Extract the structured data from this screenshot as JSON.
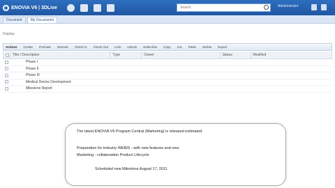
{
  "topbar": {
    "app_title": "ENOVIA V6 | 3DLive",
    "search_placeholder": "Search",
    "user_label": "Administrator"
  },
  "tabs": [
    "Document",
    "My Documents"
  ],
  "filter": {
    "label": "Display:"
  },
  "toolbar": {
    "items": [
      "Actions",
      "Create",
      "Promote",
      "Demote",
      "Check In",
      "Check Out",
      "Lock",
      "Unlock",
      "Subscribe",
      "Copy",
      "Cut",
      "Paste",
      "Delete",
      "Export"
    ]
  },
  "table": {
    "columns": [
      "Title / Description",
      "Type",
      "Owner",
      "Status",
      "Modified"
    ],
    "rows": [
      {
        "name": "Phase I"
      },
      {
        "name": "Phase II"
      },
      {
        "name": "Phase III"
      },
      {
        "name": "Medical Device Development"
      },
      {
        "name": "Milestone Report"
      }
    ]
  },
  "message": {
    "line1": "The latest ENOVIA V6 Program Central (Marketing) is released estimated.",
    "line2": "Preparation for industry WEBIS - with new features and new",
    "line3": "Marketing - collaboration Product Lifecycle",
    "line4": "Scheduled new Milestone August 17, 2011"
  }
}
